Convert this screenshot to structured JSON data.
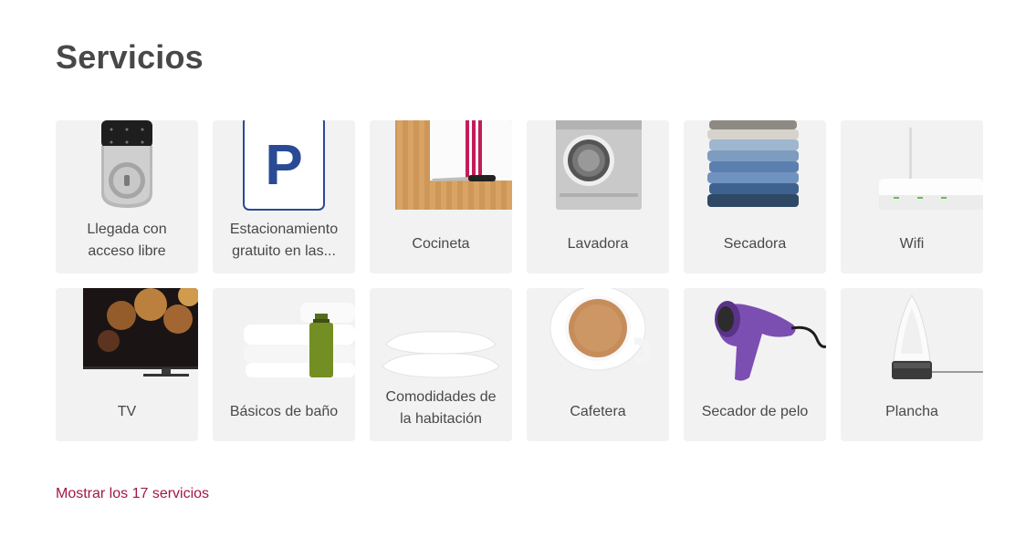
{
  "section": {
    "title": "Servicios",
    "show_all_label": "Mostrar los 17 servicios"
  },
  "amenities": [
    {
      "label": "Llegada con acceso libre",
      "lines": [
        "Llegada con",
        "acceso libre"
      ],
      "icon": "smart-lock-icon"
    },
    {
      "label": "Estacionamiento gratuito en las...",
      "lines": [
        "Estacionamiento",
        "gratuito en las..."
      ],
      "icon": "parking-sign-icon"
    },
    {
      "label": "Cocineta",
      "icon": "cutting-board-icon"
    },
    {
      "label": "Lavadora",
      "icon": "washing-machine-icon"
    },
    {
      "label": "Secadora",
      "icon": "folded-clothes-icon"
    },
    {
      "label": "Wifi",
      "icon": "wifi-router-icon"
    },
    {
      "label": "TV",
      "icon": "tv-icon"
    },
    {
      "label": "Básicos de baño",
      "icon": "towels-soap-icon"
    },
    {
      "label": "Comodidades de la habitación",
      "lines": [
        "Comodidades de",
        "la habitación"
      ],
      "icon": "pillows-icon"
    },
    {
      "label": "Cafetera",
      "icon": "coffee-cup-icon"
    },
    {
      "label": "Secador de pelo",
      "icon": "hair-dryer-icon"
    },
    {
      "label": "Plancha",
      "icon": "iron-icon"
    }
  ],
  "colors": {
    "text": "#484848",
    "card_background": "#f2f2f2",
    "link": "#a0174a"
  }
}
